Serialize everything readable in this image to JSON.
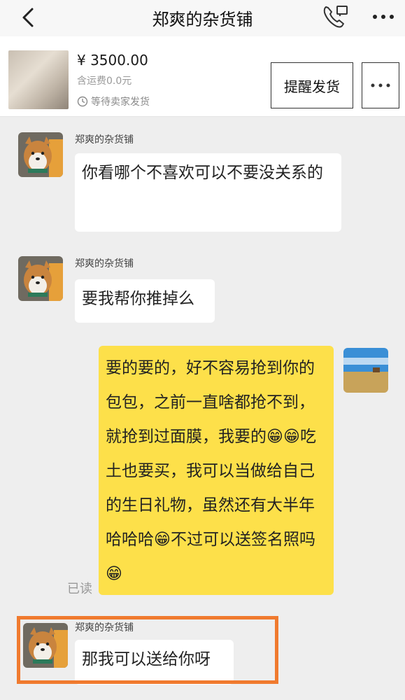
{
  "header": {
    "title": "郑爽的杂货铺"
  },
  "order": {
    "price": "¥ 3500.00",
    "shipping": "含运费0.0元",
    "status": "等待卖家发货",
    "remind_button": "提醒发货"
  },
  "messages": [
    {
      "sender": "郑爽的杂货铺",
      "text": "你看哪个不喜欢可以不要没关系的"
    },
    {
      "sender": "郑爽的杂货铺",
      "text": "要我帮你推掉么"
    },
    {
      "sender": "",
      "text": "要的要的，好不容易抢到你的包包，之前一直啥都抢不到，就抢到过面膜，我要的😁😁吃土也要买，我可以当做给自己的生日礼物，虽然还有大半年哈哈哈😁不过可以送签名照吗😁",
      "read_status": "已读"
    },
    {
      "sender": "郑爽的杂货铺",
      "text": "那我可以送给你呀"
    }
  ],
  "colors": {
    "accent_highlight": "#f07a2e",
    "my_bubble": "#fde04a"
  }
}
